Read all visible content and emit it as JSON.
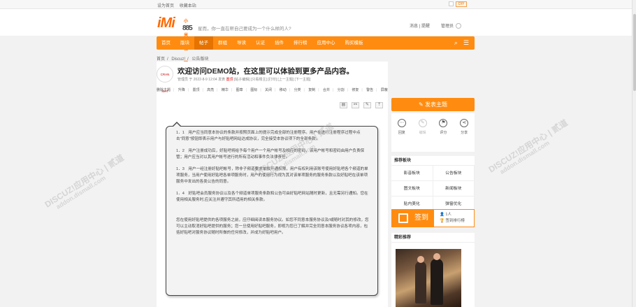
{
  "topbar": {
    "set_home": "设为首页",
    "bookmark": "收藏本站",
    "diy": "DIY"
  },
  "header": {
    "logo_main": "iMi",
    "logo_sub": "小米社区",
    "logo_num": "885",
    "slogan": "星而，你一直在帮自己要成为一个什么样的人?",
    "user_links": [
      "消息",
      "提醒",
      "管理员"
    ]
  },
  "nav": {
    "items": [
      "首页",
      "版块",
      "帖子",
      "群组",
      "导读",
      "认证",
      "插件",
      "排行榜",
      "应用中心",
      "购买模板"
    ],
    "active_index": 2
  },
  "breadcrumb": [
    "首页",
    "Discuz!",
    "公告版块"
  ],
  "post": {
    "avatar_text": "CRAN MAT",
    "title": "欢迎访问DEMO站，在这里可以体验到更多产品内容。",
    "meta_author": "管理员 于 2022-8-9 12:04 发表",
    "meta_tag": "置顶",
    "meta_rest": "[帖子编辑] [只看楼主] [打印] [上一主题] [下一主题]",
    "views": "170",
    "replies": "7",
    "tools": [
      "删除主题",
      "升降",
      "置顶",
      "高亮",
      "精华",
      "图章",
      "图标",
      "关闭",
      "移动",
      "分类",
      "复制",
      "合并",
      "分割",
      "修复",
      "警告",
      "屏蔽",
      "标签"
    ],
    "op_icons": [
      "doc-icon",
      "link-icon",
      "fav-icon",
      "up-icon"
    ],
    "content": [
      "1．1　用户应当同意本协议的条款并按照页面上的提示完成全部的注册程序。用户在进行注册程序过程中点击\"同意\"按钮即表示用户与好贴吧网站达成协议，完全接受本协议项下的全部条款。",
      "1．2　用户注册成功后，好贴吧将给予每个用户一个用户帐号及相应的密码，该用户帐号和密码由用户负责保管；用户应当对以其用户帐号进行的所有活动和事件负法律责任。",
      "1．3　用户一经注册好贴吧帐号，除非子频道要求单独开通权限，用户有权利用该账号使用好贴吧各个频道的单项服务，当用户使用好贴吧各单项服务时，用户的使用行为视为其对该单项服务的服务条款以及好贴吧在该单项服务中发出的各类公告的同意。",
      "1．4　好贴吧会员服务协议以及各个频道单项服务条款和公告可由好贴吧网站随时更新，且无需另行通知。您在使用相关服务时,应关注并遵守其所适用的相关条款。",
      "您在使用好贴吧提供的各项服务之前，应仔细阅读本服务协议。如您不同意本服务协议及/或随时对其的修改，您可以主动取消好贴吧提供的服务；您一旦使用好贴吧服务，即视为您已了解并完全同意本服务协议各项内容，包括好贴吧对服务协议随时所做的任何修改，并成为好贴吧用户。"
    ]
  },
  "sidebar": {
    "new_post": "发表主题",
    "actions": [
      {
        "label": "回复",
        "icon": "comment-icon",
        "enabled": true
      },
      {
        "label": "编辑",
        "icon": "edit-icon",
        "enabled": false
      },
      {
        "label": "评分",
        "icon": "flag-icon",
        "enabled": true
      },
      {
        "label": "分享",
        "icon": "share-icon",
        "enabled": true
      }
    ],
    "recommend_title": "推荐板块",
    "boards": [
      "影音板块",
      "公告板块",
      "图文板块",
      "新闻板块",
      "贴内美化",
      "弹窗优化"
    ],
    "signin": {
      "label": "签到",
      "count": "1人",
      "rank": "签到排行榜"
    },
    "featured_title": "精彩推荐"
  },
  "watermark": {
    "text": "DISCUZ!应用中心 | 贰道",
    "domain": "addon.dismall.com"
  },
  "colors": {
    "accent": "#ff8c10",
    "accent_dark": "#e67300"
  }
}
